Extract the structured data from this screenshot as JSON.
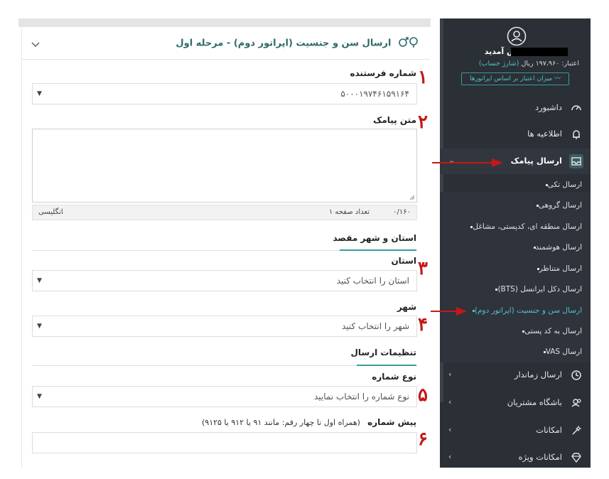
{
  "form": {
    "title": "ارسال سن و جنسیت (اپراتور دوم) - مرحله اول",
    "sender": {
      "label": "شماره فرستنده",
      "value": "۵۰۰۰۱۹۷۴۶۱۵۹۱۶۴"
    },
    "message": {
      "label": "متن پیامک",
      "value": ""
    },
    "counter": {
      "count": "۰/۱۶۰",
      "pages": "تعداد صفحه ۱",
      "language": "انگلیسی"
    },
    "destination": {
      "section_title": "استان و شهر مقصد"
    },
    "province": {
      "label": "استان",
      "placeholder": "استان را انتخاب کنید"
    },
    "city": {
      "label": "شهر",
      "placeholder": "شهر را انتخاب کنید"
    },
    "settings": {
      "section_title": "تنظیمات ارسال"
    },
    "number_type": {
      "label": "نوع شماره",
      "placeholder": "نوع شماره را انتخاب نمایید"
    },
    "prefix": {
      "label": "پیش شماره",
      "hint": "(همراه اول تا چهار رقم: مانند ۹۱ یا ۹۱۲ یا ۹۱۲۵)",
      "value": ""
    }
  },
  "steps": [
    "۱",
    "۲",
    "۳",
    "۴",
    "۵",
    "۶"
  ],
  "sidebar": {
    "welcome": "خوش آمدید",
    "credit_prefix": "اعتبار: ۱۹۷،۹۶۰ ریال",
    "credit_link": "(شارژ حساب)",
    "credit_button": "میزان اعتبار بر اساس اپراتورها",
    "nav": [
      {
        "label": "داشبورد",
        "icon": "gauge-icon"
      },
      {
        "label": "اطلاعیه ها",
        "icon": "bell-icon"
      },
      {
        "label": "ارسال پیامک",
        "icon": "inbox-icon"
      },
      {
        "label": "ارسال زماندار",
        "icon": "clock-icon"
      },
      {
        "label": "باشگاه مشتریان",
        "icon": "users-icon"
      },
      {
        "label": "امکانات",
        "icon": "magic-wand-icon"
      },
      {
        "label": "امکانات ویژه",
        "icon": "diamond-icon"
      }
    ],
    "submenu": [
      "ارسال تکی",
      "ارسال گروهی",
      "ارسال منطقه ای، کدپستی، مشاغل",
      "ارسال هوشمند",
      "ارسال متناظر",
      "ارسال دکل ایرانسل (BTS)",
      "ارسال سن و جنسیت (اپراتور دوم)",
      "ارسال به کد پستی",
      "ارسال VAS"
    ]
  },
  "colors": {
    "accent": "#3a9c9c",
    "sidebar_bg": "#2b2f36",
    "annotation": "#c41818"
  }
}
